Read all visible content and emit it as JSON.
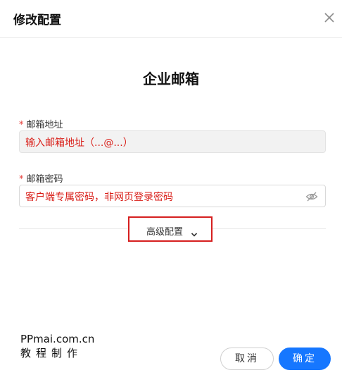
{
  "dialog": {
    "title": "修改配置",
    "close_icon": "close-icon"
  },
  "section": {
    "title": "企业邮箱"
  },
  "fields": {
    "required_mark": "*",
    "email_address": {
      "label": "邮箱地址",
      "placeholder": "输入邮箱地址（...@...）"
    },
    "email_password": {
      "label": "邮箱密码",
      "placeholder": "客户端专属密码，非网页登录密码",
      "visibility_icon": "eye-slash-icon"
    }
  },
  "advanced": {
    "label": "高级配置",
    "icon": "chevron-down-icon",
    "highlight_color": "#d61f1f"
  },
  "watermark": {
    "line1": "PPmai.com.cn",
    "line2": "教程制作"
  },
  "footer": {
    "cancel_label": "取消",
    "ok_label": "确定"
  },
  "colors": {
    "primary": "#1677ff",
    "placeholder_red": "#d91e18",
    "required_red": "#e53935"
  }
}
